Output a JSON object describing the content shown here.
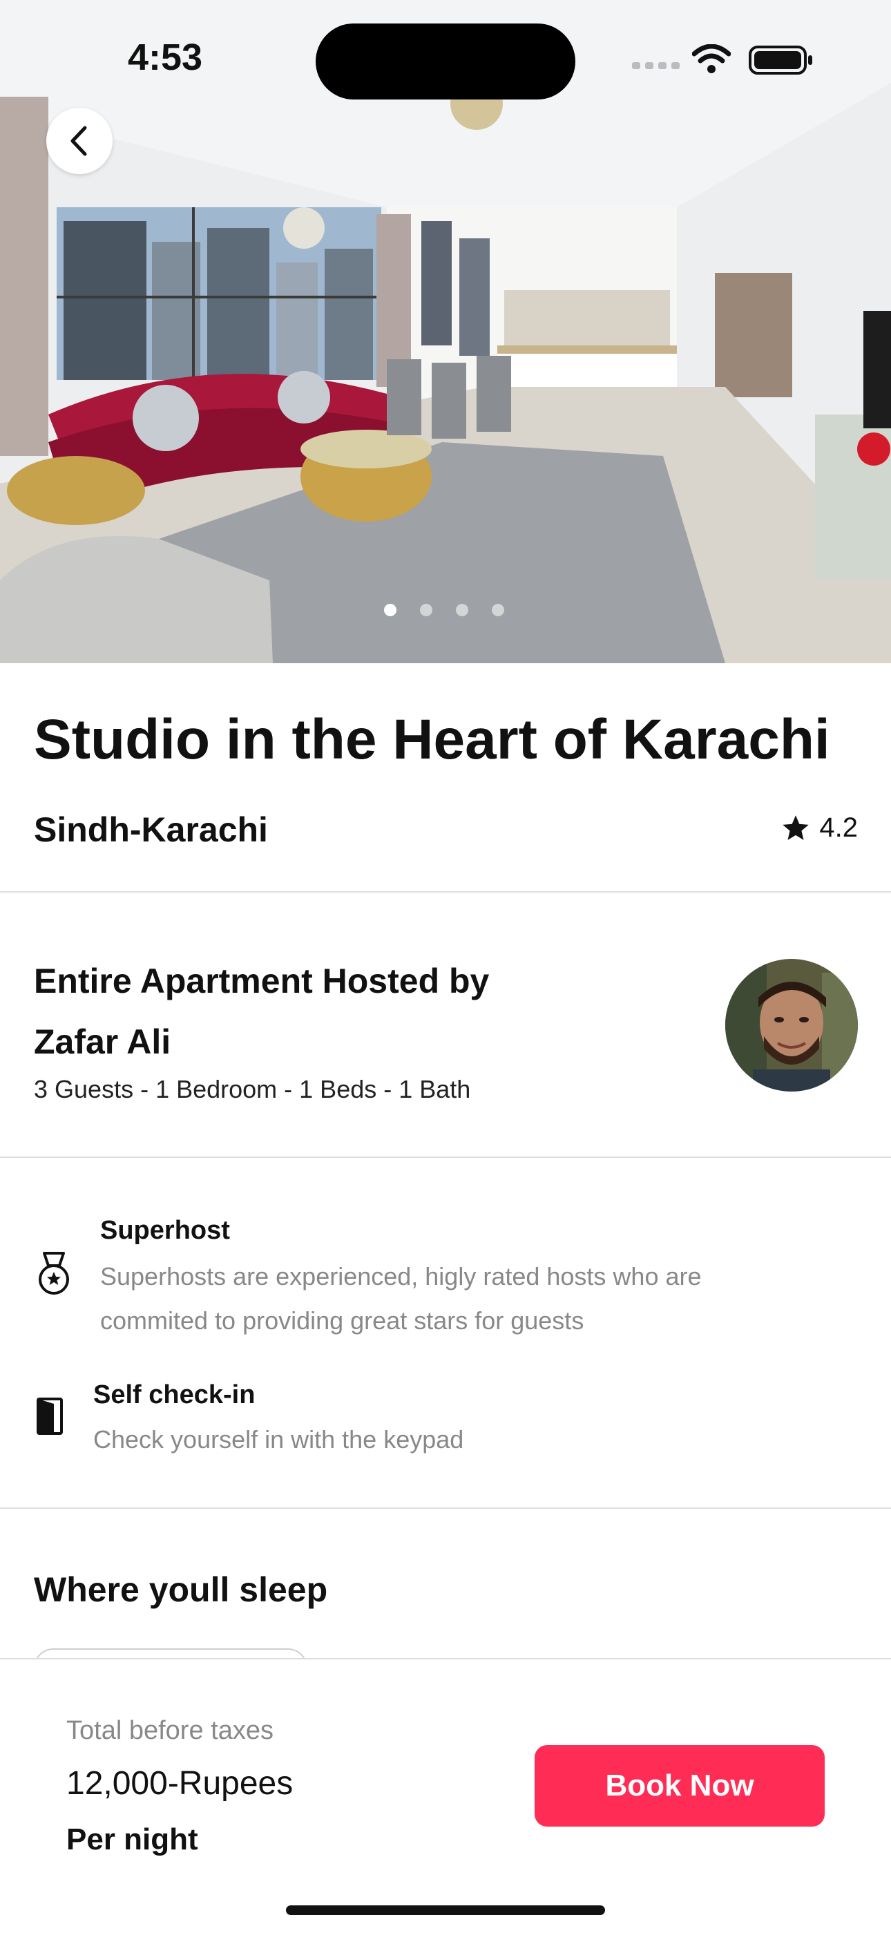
{
  "status_bar": {
    "time": "4:53"
  },
  "listing": {
    "title": "Studio in the Heart of Karachi",
    "location": "Sindh-Karachi",
    "rating": "4.2",
    "photo_pages": 4,
    "photo_current": 1
  },
  "host": {
    "title": "Entire Apartment Hosted by Zafar Ali",
    "meta": "3 Guests - 1 Bedroom - 1 Beds - 1 Bath"
  },
  "features": [
    {
      "icon": "medal-icon",
      "title": "Superhost",
      "description": "Superhosts are experienced, higly rated hosts who are commited to providing great stars for guests"
    },
    {
      "icon": "door-icon",
      "title": "Self check-in",
      "description": "Check yourself in with the keypad"
    }
  ],
  "sleep": {
    "heading": "Where youll sleep"
  },
  "footer": {
    "label": "Total before taxes",
    "price": "12,000-Rupees",
    "per": "Per night",
    "book_label": "Book Now"
  },
  "colors": {
    "accent": "#ff2d55",
    "divider": "#dedede",
    "muted_text": "#888888"
  }
}
